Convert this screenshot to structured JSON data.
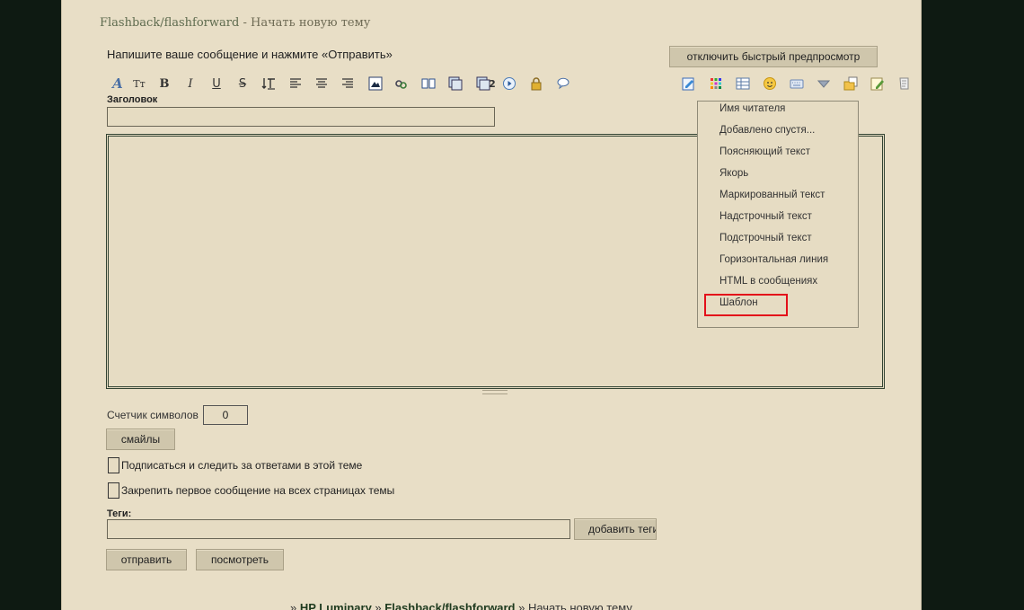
{
  "breadcrumb_top": {
    "forum": "Flashback/flashforward",
    "separator": " - ",
    "current": "Начать новую тему"
  },
  "instruction": "Напишите ваше сообщение и нажмите «Отправить»",
  "preview_toggle_label": "отключить быстрый предпросмотр",
  "toolbar": {
    "font_label": "A",
    "size_label": "Tт",
    "bold": "B",
    "italic": "I",
    "underline": "U",
    "strike": "S",
    "table_badge": "2"
  },
  "title_label": "Заголовок",
  "title_value": "",
  "message_value": "",
  "dropdown_items": [
    "Имя читателя",
    "Добавлено спустя...",
    "Поясняющий текст",
    "Якорь",
    "Маркированный текст",
    "Надстрочный текст",
    "Подстрочный текст",
    "Горизонтальная линия",
    "HTML в сообщениях",
    "Шаблон"
  ],
  "counter": {
    "label": "Счетчик символов",
    "value": "0"
  },
  "smilies_label": "смайлы",
  "checkboxes": [
    {
      "label": "Подписаться и следить за ответами в этой теме",
      "checked": false
    },
    {
      "label": "Закрепить первое сообщение на всех страницах темы",
      "checked": false
    }
  ],
  "tags": {
    "label": "Теги:",
    "value": "",
    "add_label": "добавить теги"
  },
  "send_label": "отправить",
  "preview_label": "посмотреть",
  "breadcrumb_bottom": {
    "sep1": "» ",
    "forum_root": "HP Luminary",
    "sep2": " » ",
    "forum": "Flashback/flashforward",
    "sep3": " » ",
    "current": "Начать новую тему"
  },
  "colors": {
    "highlight": "#e3101a",
    "page_bg": "#e8dec6",
    "outer_bg": "#0e1a12"
  }
}
